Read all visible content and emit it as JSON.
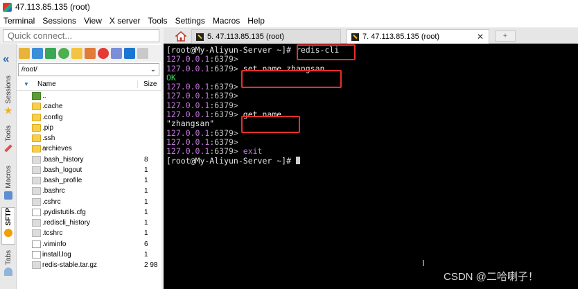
{
  "window": {
    "title": "47.113.85.135 (root)"
  },
  "menu": [
    "Terminal",
    "Sessions",
    "View",
    "X server",
    "Tools",
    "Settings",
    "Macros",
    "Help"
  ],
  "quick_connect": {
    "placeholder": "Quick connect..."
  },
  "tabs": [
    {
      "label": "5. 47.113.85.135 (root)",
      "active": false
    },
    {
      "label": "7. 47.113.85.135 (root)",
      "active": true
    }
  ],
  "tab_close_glyph": "✕",
  "add_tab_glyph": "+",
  "side_tabs": [
    "Sessions",
    "Tools",
    "Macros",
    "SFTP",
    "Tabs"
  ],
  "sftp": {
    "path": "/root/",
    "columns": {
      "name": "Name",
      "size": "Size"
    },
    "files": [
      {
        "name": "..",
        "size": "",
        "type": "up"
      },
      {
        "name": ".cache",
        "size": "",
        "type": "folder"
      },
      {
        "name": ".config",
        "size": "",
        "type": "folder"
      },
      {
        "name": ".pip",
        "size": "",
        "type": "folder"
      },
      {
        "name": ".ssh",
        "size": "",
        "type": "folder"
      },
      {
        "name": "archieves",
        "size": "",
        "type": "folder"
      },
      {
        "name": ".bash_history",
        "size": "8",
        "type": "file"
      },
      {
        "name": ".bash_logout",
        "size": "1",
        "type": "file"
      },
      {
        "name": ".bash_profile",
        "size": "1",
        "type": "file"
      },
      {
        "name": ".bashrc",
        "size": "1",
        "type": "file"
      },
      {
        "name": ".cshrc",
        "size": "1",
        "type": "file"
      },
      {
        "name": ".pydistutils.cfg",
        "size": "1",
        "type": "plain"
      },
      {
        "name": ".rediscli_history",
        "size": "1",
        "type": "file"
      },
      {
        "name": ".tcshrc",
        "size": "1",
        "type": "file"
      },
      {
        "name": ".viminfo",
        "size": "6",
        "type": "plain"
      },
      {
        "name": "install.log",
        "size": "1",
        "type": "plain"
      },
      {
        "name": "redis-stable.tar.gz",
        "size": "2 98",
        "type": "file"
      }
    ]
  },
  "terminal": {
    "lines": [
      [
        {
          "t": "[root@My-Aliyun-Server ~]# ",
          "c": "white"
        },
        {
          "t": "redis-cli",
          "c": "white"
        }
      ],
      [
        {
          "t": "127.0.0.1",
          "c": "purple"
        },
        {
          "t": ":6379>",
          "c": "gray"
        }
      ],
      [
        {
          "t": "127.0.0.1",
          "c": "purple"
        },
        {
          "t": ":6379> ",
          "c": "gray"
        },
        {
          "t": "set name zhangsan",
          "c": "white"
        }
      ],
      [
        {
          "t": "OK",
          "c": "green"
        }
      ],
      [
        {
          "t": "127.0.0.1",
          "c": "purple"
        },
        {
          "t": ":6379>",
          "c": "gray"
        }
      ],
      [
        {
          "t": "127.0.0.1",
          "c": "purple"
        },
        {
          "t": ":6379>",
          "c": "gray"
        }
      ],
      [
        {
          "t": "127.0.0.1",
          "c": "purple"
        },
        {
          "t": ":6379>",
          "c": "gray"
        }
      ],
      [
        {
          "t": "127.0.0.1",
          "c": "purple"
        },
        {
          "t": ":6379> ",
          "c": "gray"
        },
        {
          "t": "get name",
          "c": "white"
        }
      ],
      [
        {
          "t": "\"zhangsan\"",
          "c": "white"
        }
      ],
      [
        {
          "t": "127.0.0.1",
          "c": "purple"
        },
        {
          "t": ":6379>",
          "c": "gray"
        }
      ],
      [
        {
          "t": "127.0.0.1",
          "c": "purple"
        },
        {
          "t": ":6379>",
          "c": "gray"
        }
      ],
      [
        {
          "t": "127.0.0.1",
          "c": "purple"
        },
        {
          "t": ":6379> ",
          "c": "gray"
        },
        {
          "t": "exit",
          "c": "purple"
        }
      ],
      [
        {
          "t": "[root@My-Aliyun-Server ~]# ",
          "c": "white"
        },
        {
          "t": "",
          "c": "cursor"
        }
      ]
    ],
    "highlight_color": "#e8302a"
  },
  "watermark": "CSDN @二哈喇子！",
  "ibeam_glyph": "I"
}
